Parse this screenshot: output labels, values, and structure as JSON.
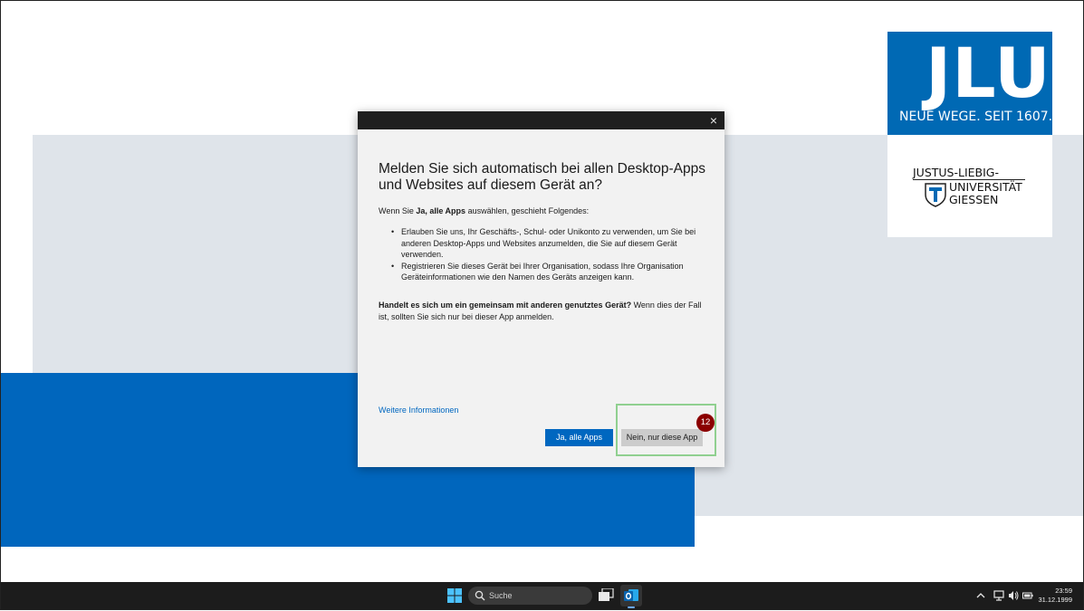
{
  "background": {
    "colors": {
      "accent_blue": "#0066bd",
      "band_grey": "#dfe4ea"
    }
  },
  "logo": {
    "initials": "JLU",
    "tagline": "NEUE WEGE. SEIT 1607.",
    "university_line1": "JUSTUS-LIEBIG-",
    "university_line2": "UNIVERSITÄT",
    "university_line3": "GIESSEN"
  },
  "dialog": {
    "close_glyph": "×",
    "title": "Melden Sie sich automatisch bei allen Desktop-Apps und Websites auf diesem Gerät an?",
    "intro_prefix": "Wenn Sie ",
    "intro_bold": "Ja, alle Apps",
    "intro_suffix": " auswählen, geschieht Folgendes:",
    "bullets": [
      "Erlauben Sie uns, Ihr Geschäfts-, Schul- oder Unikonto zu verwenden, um Sie bei anderen Desktop-Apps und Websites anzumelden, die Sie auf diesem Gerät verwenden.",
      "Registrieren Sie dieses Gerät bei Ihrer Organisation, sodass Ihre Organisation Geräteinformationen wie den Namen des Geräts anzeigen kann."
    ],
    "shared_bold": "Handelt es sich um ein gemeinsam mit anderen genutztes Gerät?",
    "shared_text": " Wenn dies der Fall ist, sollten Sie sich nur bei dieser App anmelden.",
    "more_info_link": "Weitere Informationen",
    "yes_button": "Ja, alle Apps",
    "no_button": "Nein, nur diese App",
    "step_badge": "12"
  },
  "taskbar": {
    "search_placeholder": "Suche",
    "icons": [
      "windows-start-icon",
      "search-icon",
      "task-view-icon",
      "outlook-icon",
      "chevron-up-icon",
      "network-icon",
      "volume-icon",
      "battery-icon"
    ],
    "time": "23:59",
    "date": "31.12.1999"
  }
}
